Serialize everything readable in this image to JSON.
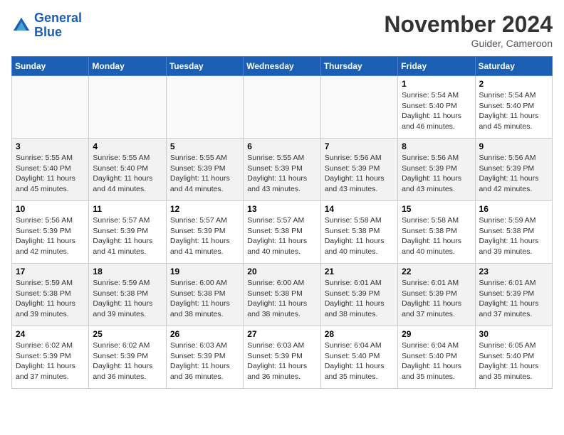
{
  "logo": {
    "line1": "General",
    "line2": "Blue"
  },
  "title": "November 2024",
  "location": "Guider, Cameroon",
  "days_of_week": [
    "Sunday",
    "Monday",
    "Tuesday",
    "Wednesday",
    "Thursday",
    "Friday",
    "Saturday"
  ],
  "weeks": [
    [
      {
        "day": "",
        "info": ""
      },
      {
        "day": "",
        "info": ""
      },
      {
        "day": "",
        "info": ""
      },
      {
        "day": "",
        "info": ""
      },
      {
        "day": "",
        "info": ""
      },
      {
        "day": "1",
        "info": "Sunrise: 5:54 AM\nSunset: 5:40 PM\nDaylight: 11 hours\nand 46 minutes."
      },
      {
        "day": "2",
        "info": "Sunrise: 5:54 AM\nSunset: 5:40 PM\nDaylight: 11 hours\nand 45 minutes."
      }
    ],
    [
      {
        "day": "3",
        "info": "Sunrise: 5:55 AM\nSunset: 5:40 PM\nDaylight: 11 hours\nand 45 minutes."
      },
      {
        "day": "4",
        "info": "Sunrise: 5:55 AM\nSunset: 5:40 PM\nDaylight: 11 hours\nand 44 minutes."
      },
      {
        "day": "5",
        "info": "Sunrise: 5:55 AM\nSunset: 5:39 PM\nDaylight: 11 hours\nand 44 minutes."
      },
      {
        "day": "6",
        "info": "Sunrise: 5:55 AM\nSunset: 5:39 PM\nDaylight: 11 hours\nand 43 minutes."
      },
      {
        "day": "7",
        "info": "Sunrise: 5:56 AM\nSunset: 5:39 PM\nDaylight: 11 hours\nand 43 minutes."
      },
      {
        "day": "8",
        "info": "Sunrise: 5:56 AM\nSunset: 5:39 PM\nDaylight: 11 hours\nand 43 minutes."
      },
      {
        "day": "9",
        "info": "Sunrise: 5:56 AM\nSunset: 5:39 PM\nDaylight: 11 hours\nand 42 minutes."
      }
    ],
    [
      {
        "day": "10",
        "info": "Sunrise: 5:56 AM\nSunset: 5:39 PM\nDaylight: 11 hours\nand 42 minutes."
      },
      {
        "day": "11",
        "info": "Sunrise: 5:57 AM\nSunset: 5:39 PM\nDaylight: 11 hours\nand 41 minutes."
      },
      {
        "day": "12",
        "info": "Sunrise: 5:57 AM\nSunset: 5:39 PM\nDaylight: 11 hours\nand 41 minutes."
      },
      {
        "day": "13",
        "info": "Sunrise: 5:57 AM\nSunset: 5:38 PM\nDaylight: 11 hours\nand 40 minutes."
      },
      {
        "day": "14",
        "info": "Sunrise: 5:58 AM\nSunset: 5:38 PM\nDaylight: 11 hours\nand 40 minutes."
      },
      {
        "day": "15",
        "info": "Sunrise: 5:58 AM\nSunset: 5:38 PM\nDaylight: 11 hours\nand 40 minutes."
      },
      {
        "day": "16",
        "info": "Sunrise: 5:59 AM\nSunset: 5:38 PM\nDaylight: 11 hours\nand 39 minutes."
      }
    ],
    [
      {
        "day": "17",
        "info": "Sunrise: 5:59 AM\nSunset: 5:38 PM\nDaylight: 11 hours\nand 39 minutes."
      },
      {
        "day": "18",
        "info": "Sunrise: 5:59 AM\nSunset: 5:38 PM\nDaylight: 11 hours\nand 39 minutes."
      },
      {
        "day": "19",
        "info": "Sunrise: 6:00 AM\nSunset: 5:38 PM\nDaylight: 11 hours\nand 38 minutes."
      },
      {
        "day": "20",
        "info": "Sunrise: 6:00 AM\nSunset: 5:38 PM\nDaylight: 11 hours\nand 38 minutes."
      },
      {
        "day": "21",
        "info": "Sunrise: 6:01 AM\nSunset: 5:39 PM\nDaylight: 11 hours\nand 38 minutes."
      },
      {
        "day": "22",
        "info": "Sunrise: 6:01 AM\nSunset: 5:39 PM\nDaylight: 11 hours\nand 37 minutes."
      },
      {
        "day": "23",
        "info": "Sunrise: 6:01 AM\nSunset: 5:39 PM\nDaylight: 11 hours\nand 37 minutes."
      }
    ],
    [
      {
        "day": "24",
        "info": "Sunrise: 6:02 AM\nSunset: 5:39 PM\nDaylight: 11 hours\nand 37 minutes."
      },
      {
        "day": "25",
        "info": "Sunrise: 6:02 AM\nSunset: 5:39 PM\nDaylight: 11 hours\nand 36 minutes."
      },
      {
        "day": "26",
        "info": "Sunrise: 6:03 AM\nSunset: 5:39 PM\nDaylight: 11 hours\nand 36 minutes."
      },
      {
        "day": "27",
        "info": "Sunrise: 6:03 AM\nSunset: 5:39 PM\nDaylight: 11 hours\nand 36 minutes."
      },
      {
        "day": "28",
        "info": "Sunrise: 6:04 AM\nSunset: 5:40 PM\nDaylight: 11 hours\nand 35 minutes."
      },
      {
        "day": "29",
        "info": "Sunrise: 6:04 AM\nSunset: 5:40 PM\nDaylight: 11 hours\nand 35 minutes."
      },
      {
        "day": "30",
        "info": "Sunrise: 6:05 AM\nSunset: 5:40 PM\nDaylight: 11 hours\nand 35 minutes."
      }
    ]
  ]
}
